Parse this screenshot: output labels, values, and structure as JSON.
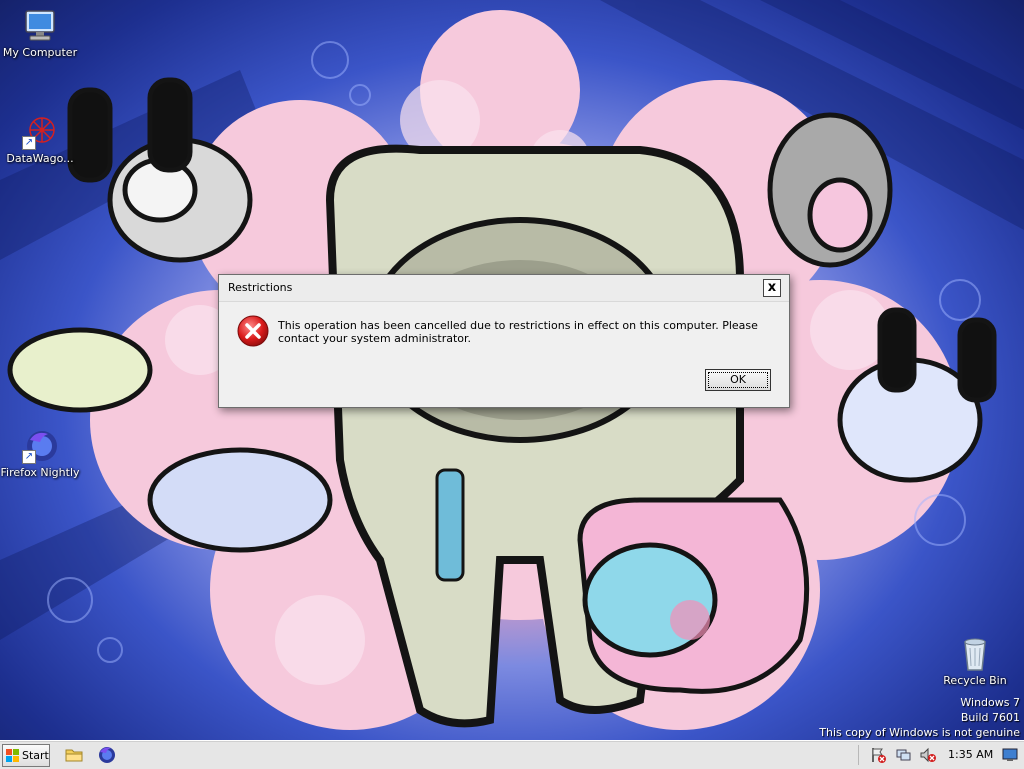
{
  "desktop": {
    "icons": [
      {
        "label": "My Computer",
        "icon": "computer-icon"
      },
      {
        "label": "DataWago...",
        "icon": "datawagon-icon"
      },
      {
        "label": "Firefox Nightly",
        "icon": "firefox-nightly-icon"
      },
      {
        "label": "Recycle Bin",
        "icon": "recycle-bin-icon"
      }
    ],
    "watermark": {
      "line1": "Windows 7",
      "line2": "Build 7601",
      "line3": "This copy of Windows is not genuine"
    }
  },
  "dialog": {
    "title": "Restrictions",
    "close_label": "x",
    "icon": "error-icon",
    "message": "This operation has been cancelled due to restrictions in effect on this computer. Please contact your system administrator.",
    "ok_label": "OK"
  },
  "taskbar": {
    "start_label": "Start",
    "pinned": [
      {
        "icon": "folder-icon"
      },
      {
        "icon": "firefox-nightly-icon"
      }
    ],
    "tray": [
      {
        "icon": "action-center-icon"
      },
      {
        "icon": "network-icon"
      },
      {
        "icon": "volume-muted-icon"
      }
    ],
    "clock": "1:35 AM",
    "show_desktop_icon": "show-desktop-icon"
  },
  "colors": {
    "wallpaper_pink": "#f3b6cf",
    "wallpaper_blue": "#1d2f8f",
    "error_red": "#c8102e",
    "taskbar": "#e6e6e6"
  }
}
